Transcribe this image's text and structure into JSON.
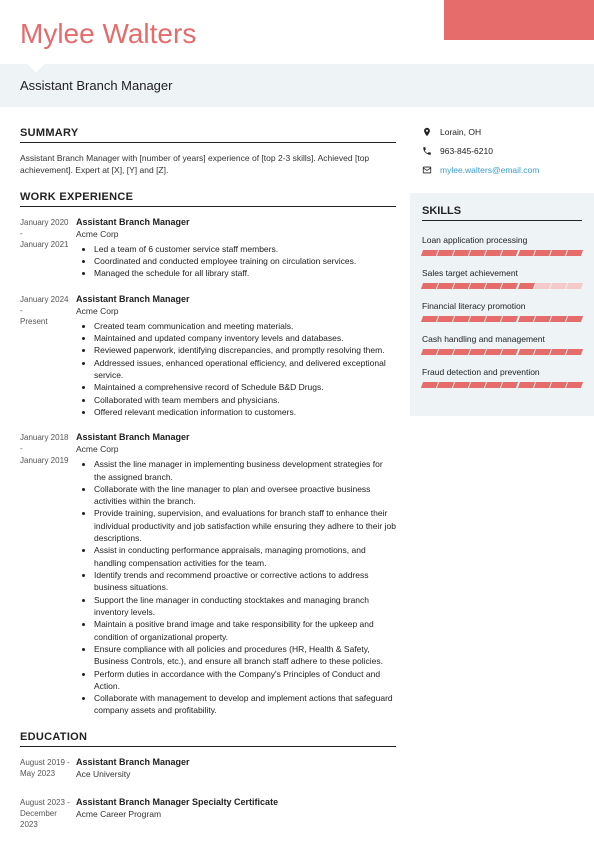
{
  "name": "Mylee Walters",
  "title": "Assistant Branch Manager",
  "contact": {
    "location": "Lorain, OH",
    "phone": "963-845-6210",
    "email": "mylee.walters@email.com"
  },
  "headings": {
    "summary": "SUMMARY",
    "work": "WORK EXPERIENCE",
    "education": "EDUCATION",
    "skills": "SKILLS"
  },
  "summary": "Assistant Branch Manager with [number of years] experience of [top 2-3 skills]. Achieved [top achievement]. Expert at [X], [Y] and [Z].",
  "work": [
    {
      "start": "January 2020",
      "end": "January 2021",
      "title": "Assistant Branch Manager",
      "company": "Acme Corp",
      "bullets": [
        "Led a team of 6 customer service staff members.",
        "Coordinated and conducted employee training on circulation services.",
        "Managed the schedule for all library staff."
      ]
    },
    {
      "start": "January 2024",
      "end": "Present",
      "title": "Assistant Branch Manager",
      "company": "Acme Corp",
      "bullets": [
        "Created team communication and meeting materials.",
        "Maintained and updated company inventory levels and databases.",
        "Reviewed paperwork, identifying discrepancies, and promptly resolving them.",
        "Addressed issues, enhanced operational efficiency, and delivered exceptional service.",
        "Maintained a comprehensive record of Schedule B&D Drugs.",
        "Collaborated with team members and physicians.",
        "Offered relevant medication information to customers."
      ]
    },
    {
      "start": "January 2018",
      "end": "January 2019",
      "title": "Assistant Branch Manager",
      "company": "Acme Corp",
      "bullets": [
        "Assist the line manager in implementing business development strategies for the assigned branch.",
        "Collaborate with the line manager to plan and oversee proactive business activities within the branch.",
        "Provide training, supervision, and evaluations for branch staff to enhance their individual productivity and job satisfaction while ensuring they adhere to their job descriptions.",
        "Assist in conducting performance appraisals, managing promotions, and handling compensation activities for the team.",
        "Identify trends and recommend proactive or corrective actions to address business situations.",
        "Support the line manager in conducting stocktakes and managing branch inventory levels.",
        "Maintain a positive brand image and take responsibility for the upkeep and condition of organizational property.",
        "Ensure compliance with all policies and procedures (HR, Health & Safety, Business Controls, etc.), and ensure all branch staff adhere to these policies.",
        "Perform duties in accordance with the Company's Principles of Conduct and Action.",
        "Collaborate with management to develop and implement actions that safeguard company assets and profitability."
      ]
    }
  ],
  "education": [
    {
      "start": "August 2019",
      "end": "May 2023",
      "title": "Assistant Branch Manager",
      "institution": "Ace University"
    },
    {
      "start": "August 2023",
      "end": "December 2023",
      "title": "Assistant Branch Manager Specialty Certificate",
      "institution": "Acme Career Program"
    }
  ],
  "skills": [
    {
      "label": "Loan application processing",
      "level": 10
    },
    {
      "label": "Sales target achievement",
      "level": 7
    },
    {
      "label": "Financial literacy promotion",
      "level": 10
    },
    {
      "label": "Cash handling and management",
      "level": 10
    },
    {
      "label": "Fraud detection and prevention",
      "level": 10
    }
  ]
}
